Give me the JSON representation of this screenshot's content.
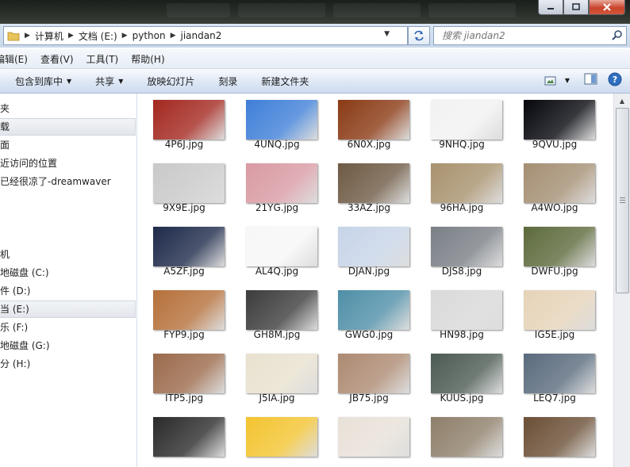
{
  "address": {
    "breadcrumbs": [
      "计算机",
      "文档 (E:)",
      "python",
      "jiandan2"
    ],
    "search_placeholder": "搜索 jiandan2"
  },
  "menu": [
    "编辑(E)",
    "查看(V)",
    "工具(T)",
    "帮助(H)"
  ],
  "toolbar": {
    "include_library": "包含到库中",
    "share": "共享",
    "slideshow": "放映幻灯片",
    "burn": "刻录",
    "new_folder": "新建文件夹"
  },
  "nav": [
    {
      "label": "夹",
      "selected": false
    },
    {
      "label": "载",
      "selected": true
    },
    {
      "label": "面",
      "selected": false
    },
    {
      "label": "近访问的位置",
      "selected": false
    },
    {
      "label": "已经很凉了-dreamwaver",
      "selected": false
    },
    {
      "label": "机",
      "selected": false
    },
    {
      "label": "地磁盘 (C:)",
      "selected": false
    },
    {
      "label": "件 (D:)",
      "selected": false
    },
    {
      "label": "当 (E:)",
      "selected": true
    },
    {
      "label": "乐 (F:)",
      "selected": false
    },
    {
      "label": "地磁盘 (G:)",
      "selected": false
    },
    {
      "label": "分 (H:)",
      "selected": false
    }
  ],
  "files": [
    {
      "name": "4P6J.jpg",
      "color": "#a3281f"
    },
    {
      "name": "4UNQ.jpg",
      "color": "#3f7fd8"
    },
    {
      "name": "6N0X.jpg",
      "color": "#8a3a14"
    },
    {
      "name": "9NHQ.jpg",
      "color": "#f2f2f2"
    },
    {
      "name": "9QVU.jpg",
      "color": "#05070d"
    },
    {
      "name": "9X9E.jpg",
      "color": "#c9c9c9"
    },
    {
      "name": "21YG.jpg",
      "color": "#d99aa3"
    },
    {
      "name": "33AZ.jpg",
      "color": "#6e5a44"
    },
    {
      "name": "96HA.jpg",
      "color": "#a8926e"
    },
    {
      "name": "A4WO.jpg",
      "color": "#a48f73"
    },
    {
      "name": "A5ZF.jpg",
      "color": "#1e2a4a"
    },
    {
      "name": "AL4Q.jpg",
      "color": "#f7f7f7"
    },
    {
      "name": "DJAN.jpg",
      "color": "#c7d4e8"
    },
    {
      "name": "DJS8.jpg",
      "color": "#7a7f86"
    },
    {
      "name": "DWFU.jpg",
      "color": "#5d6a3c"
    },
    {
      "name": "FYP9.jpg",
      "color": "#b5703a"
    },
    {
      "name": "GH8M.jpg",
      "color": "#3c3c3c"
    },
    {
      "name": "GWG0.jpg",
      "color": "#4f8fa8"
    },
    {
      "name": "HN98.jpg",
      "color": "#d9d9d9"
    },
    {
      "name": "IG5E.jpg",
      "color": "#e6d3b8"
    },
    {
      "name": "ITP5.jpg",
      "color": "#9b6a4b"
    },
    {
      "name": "J5IA.jpg",
      "color": "#e9e1cf"
    },
    {
      "name": "JB75.jpg",
      "color": "#ad8a72"
    },
    {
      "name": "KUUS.jpg",
      "color": "#4b5a52"
    },
    {
      "name": "LEQ7.jpg",
      "color": "#5a6b7d"
    },
    {
      "name": "",
      "color": "#2a2a2a"
    },
    {
      "name": "",
      "color": "#f3c430"
    },
    {
      "name": "",
      "color": "#e8e1d8"
    },
    {
      "name": "",
      "color": "#8e7f6a"
    },
    {
      "name": "",
      "color": "#6b4f36"
    }
  ]
}
